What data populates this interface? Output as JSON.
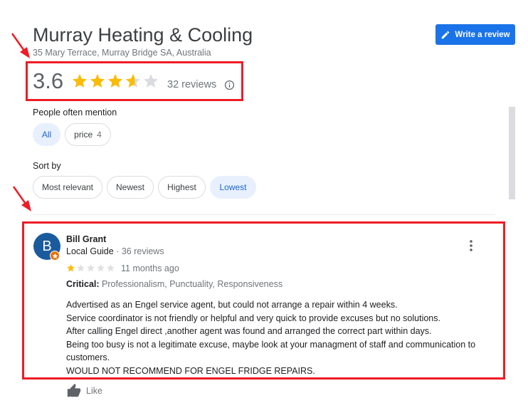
{
  "business": {
    "name": "Murray Heating & Cooling",
    "address": "35 Mary Terrace, Murray Bridge SA, Australia",
    "rating": "3.6",
    "rating_value": 3.6,
    "reviews_label": "32 reviews",
    "write_review_label": "Write a review"
  },
  "mentions": {
    "label": "People often mention",
    "chips": [
      {
        "label": "All",
        "count": "",
        "selected": true
      },
      {
        "label": "price",
        "count": "4",
        "selected": false
      }
    ]
  },
  "sort": {
    "label": "Sort by",
    "options": [
      {
        "label": "Most relevant",
        "selected": false
      },
      {
        "label": "Newest",
        "selected": false
      },
      {
        "label": "Highest",
        "selected": false
      },
      {
        "label": "Lowest",
        "selected": true
      }
    ]
  },
  "review": {
    "avatar_letter": "B",
    "name": "Bill Grant",
    "guide_label": "Local Guide",
    "meta_separator": " · ",
    "review_count": "36 reviews",
    "stars": 1,
    "time": "11 months ago",
    "critical_label": "Critical:",
    "critical_items": "Professionalism, Punctuality, Responsiveness",
    "text_lines": [
      "Advertised as an Engel service agent, but could not arrange a repair within 4 weeks.",
      "Service coordinator is not friendly or helpful and very quick to provide excuses but no solutions.",
      "After calling Engel direct ,another agent was found and arranged the correct part within days.",
      "Being too busy is not a legitimate excuse, maybe look at your managment of staff and communication to customers.",
      "WOULD NOT RECOMMEND FOR ENGEL FRIDGE REPAIRS."
    ],
    "like_label": "Like"
  },
  "colors": {
    "accent": "#1a73e8",
    "star": "#fbbc04",
    "annotation_red": "#ee1c25",
    "selected_chip_bg": "#e8f0fe"
  }
}
